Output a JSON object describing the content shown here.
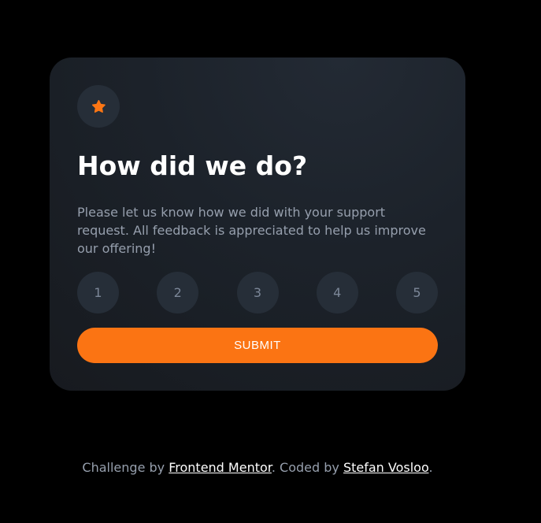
{
  "colors": {
    "page_background": "#000000",
    "card_background": "#1c222a",
    "circle_background": "#262e38",
    "accent_orange": "#fb7413",
    "text_white": "#ffffff",
    "text_muted": "#969fad"
  },
  "card": {
    "icon": "star-icon",
    "title": "How did we do?",
    "description": "Please let us know how we did with your support request. All feedback is appreciated to help us improve our offering!",
    "ratings": [
      "1",
      "2",
      "3",
      "4",
      "5"
    ],
    "submit_label": "SUBMIT"
  },
  "footer": {
    "prefix": "Challenge by ",
    "link1": "Frontend Mentor",
    "middle": ". Coded by ",
    "link2": "Stefan Vosloo",
    "suffix": "."
  }
}
